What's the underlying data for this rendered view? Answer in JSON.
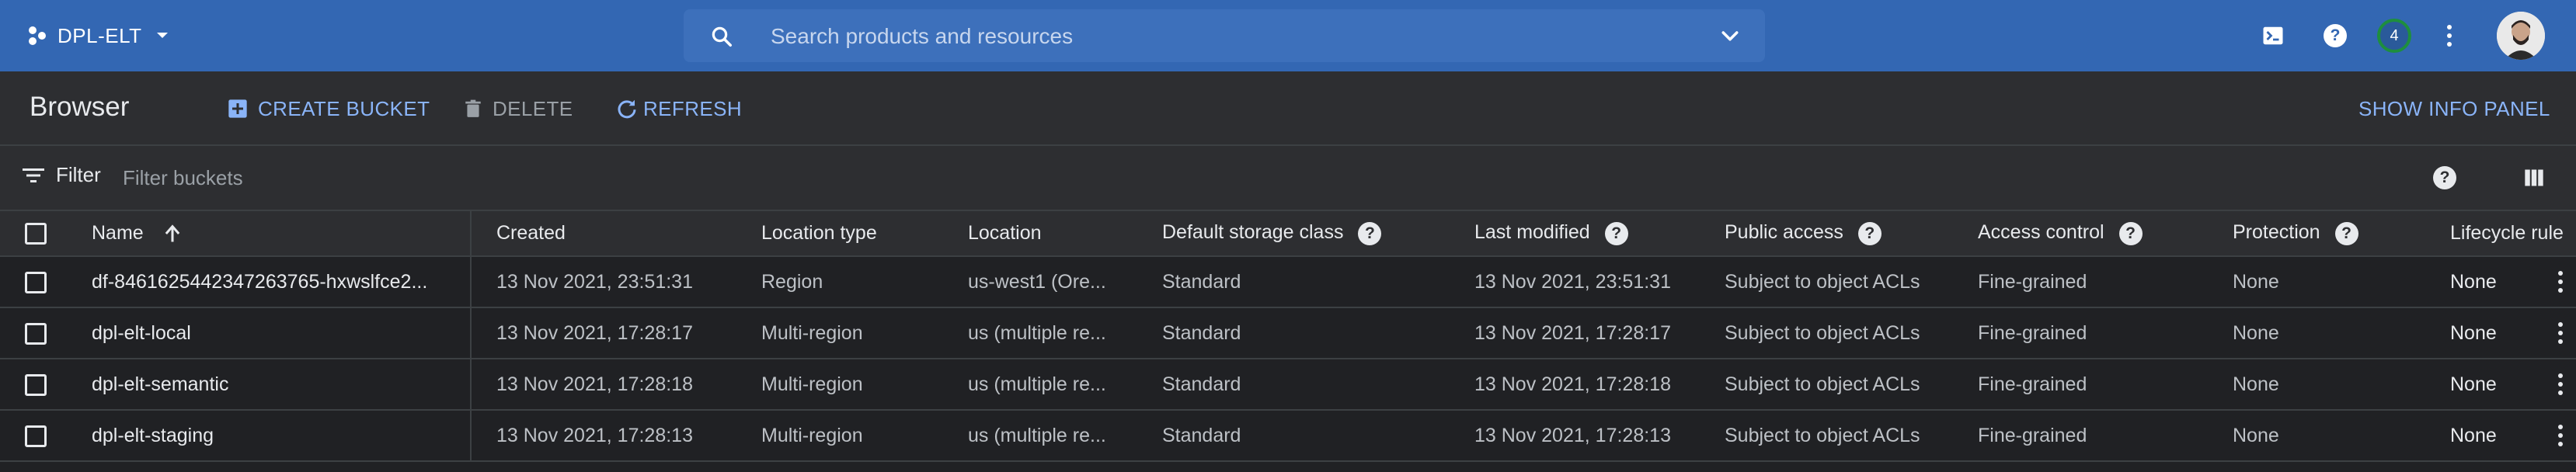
{
  "topbar": {
    "project_name": "DPL-ELT",
    "search_placeholder": "Search products and resources",
    "notification_count": "4",
    "bg_color": "#3367b3"
  },
  "toolbar": {
    "title": "Browser",
    "create_bucket": "CREATE BUCKET",
    "delete": "DELETE",
    "refresh": "REFRESH",
    "show_info_panel": "SHOW INFO PANEL"
  },
  "filter": {
    "label": "Filter",
    "placeholder": "Filter buckets"
  },
  "table": {
    "columns": {
      "name": "Name",
      "created": "Created",
      "location_type": "Location type",
      "location": "Location",
      "storage_class": "Default storage class",
      "last_modified": "Last modified",
      "public_access": "Public access",
      "access_control": "Access control",
      "protection": "Protection",
      "lifecycle": "Lifecycle rule"
    },
    "rows": [
      {
        "name": "df-8461625442347263765-hxwslfce2...",
        "created": "13 Nov 2021, 23:51:31",
        "location_type": "Region",
        "location": "us-west1 (Ore...",
        "storage_class": "Standard",
        "last_modified": "13 Nov 2021, 23:51:31",
        "public_access": "Subject to object ACLs",
        "access_control": "Fine-grained",
        "protection": "None",
        "lifecycle": "None"
      },
      {
        "name": "dpl-elt-local",
        "created": "13 Nov 2021, 17:28:17",
        "location_type": "Multi-region",
        "location": "us (multiple re...",
        "storage_class": "Standard",
        "last_modified": "13 Nov 2021, 17:28:17",
        "public_access": "Subject to object ACLs",
        "access_control": "Fine-grained",
        "protection": "None",
        "lifecycle": "None"
      },
      {
        "name": "dpl-elt-semantic",
        "created": "13 Nov 2021, 17:28:18",
        "location_type": "Multi-region",
        "location": "us (multiple re...",
        "storage_class": "Standard",
        "last_modified": "13 Nov 2021, 17:28:18",
        "public_access": "Subject to object ACLs",
        "access_control": "Fine-grained",
        "protection": "None",
        "lifecycle": "None"
      },
      {
        "name": "dpl-elt-staging",
        "created": "13 Nov 2021, 17:28:13",
        "location_type": "Multi-region",
        "location": "us (multiple re...",
        "storage_class": "Standard",
        "last_modified": "13 Nov 2021, 17:28:13",
        "public_access": "Subject to object ACLs",
        "access_control": "Fine-grained",
        "protection": "None",
        "lifecycle": "None"
      }
    ]
  }
}
